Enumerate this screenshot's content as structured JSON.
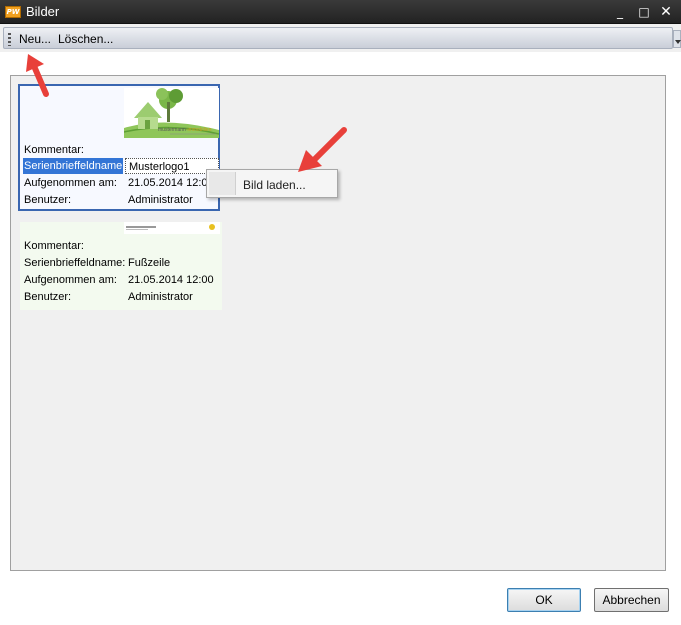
{
  "window": {
    "icon_text": "PW",
    "title": "Bilder",
    "minimize": "_",
    "maximize": "□",
    "close": "✕"
  },
  "toolbar": {
    "new_label": "Neu...",
    "delete_label": "Löschen..."
  },
  "cards": [
    {
      "comment_label": "Kommentar:",
      "field_label": "Serienbrieffeldname:",
      "field_value": "Musterlogo1",
      "recorded_label": "Aufgenommen am:",
      "recorded_value": "21.05.2014 12:00",
      "user_label": "Benutzer:",
      "user_value": "Administrator",
      "selected": true
    },
    {
      "comment_label": "Kommentar:",
      "field_label": "Serienbrieffeldname:",
      "field_value": "Fußzeile",
      "recorded_label": "Aufgenommen am:",
      "recorded_value": "21.05.2014 12:00",
      "user_label": "Benutzer:",
      "user_value": "Administrator",
      "selected": false
    }
  ],
  "context_menu": {
    "item": "Bild laden..."
  },
  "buttons": {
    "ok": "OK",
    "cancel": "Abbrechen"
  },
  "colors": {
    "selection": "#3375d6",
    "arrow": "#e8403a",
    "title_bar": "#2b2b2b"
  }
}
